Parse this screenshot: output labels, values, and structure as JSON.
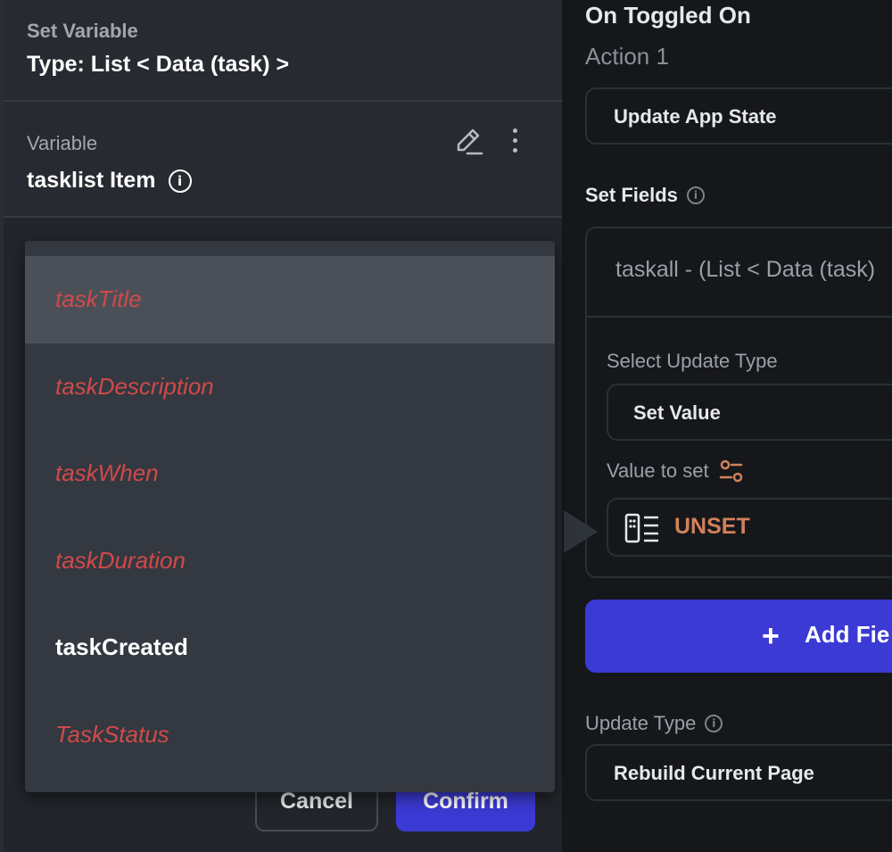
{
  "set_variable": {
    "label": "Set Variable",
    "type": "Type: List < Data (task) >"
  },
  "variable": {
    "label": "Variable",
    "name": "tasklist Item",
    "icons": [
      "info-icon",
      "edit-icon",
      "more-vertical-icon"
    ]
  },
  "dropdown": {
    "items": [
      {
        "label": "taskTitle",
        "style": "italic-red",
        "highlighted": true
      },
      {
        "label": "taskDescription",
        "style": "italic-red",
        "highlighted": false
      },
      {
        "label": "taskWhen",
        "style": "italic-red",
        "highlighted": false
      },
      {
        "label": "taskDuration",
        "style": "italic-red",
        "highlighted": false
      },
      {
        "label": "taskCreated",
        "style": "bold-white",
        "highlighted": false
      },
      {
        "label": "TaskStatus",
        "style": "italic-red",
        "highlighted": false
      }
    ]
  },
  "footer": {
    "cancel_label": "Cancel",
    "confirm_label": "Confirm"
  },
  "action_panel": {
    "title": "On Toggled On",
    "action_label": "Action 1",
    "action_type": "Update App State",
    "set_fields_label": "Set Fields",
    "field_text": "taskall - (List < Data (task)",
    "select_update_type_label": "Select Update Type",
    "update_type_value": "Set Value",
    "value_to_set_label": "Value to set",
    "value_text": "UNSET",
    "add_field_plus": "+",
    "add_field_label": "Add Fie",
    "update_type_label": "Update Type",
    "update_type_option": "Rebuild Current Page"
  },
  "colors": {
    "accent": "#3c3ad4",
    "unset": "#d2815a",
    "error_red": "#d04a4a",
    "background": "#15171b"
  }
}
